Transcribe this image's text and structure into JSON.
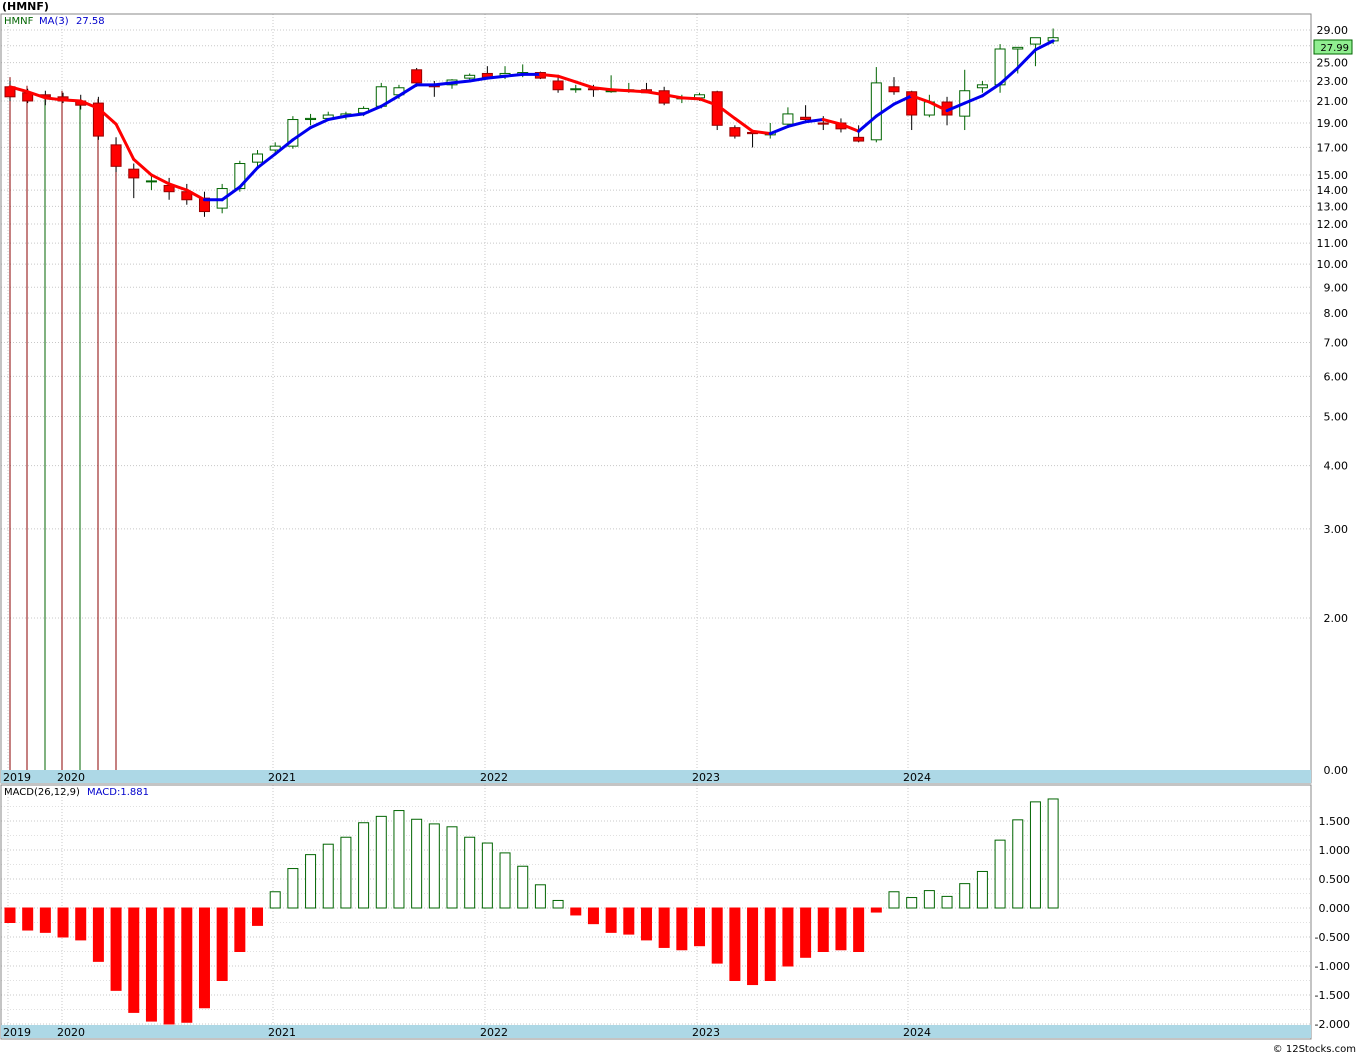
{
  "symbol_title": "(HMNF)",
  "copyright": "© 12Stocks.com",
  "colors": {
    "up": "#006400",
    "down": "#ff0000",
    "ma_rising": "#0000ee",
    "ma_falling": "#ff0000",
    "axis_band": "#add8e6",
    "grid": "#c8c8c8",
    "price_label_bg": "#90ee90"
  },
  "chart_data": [
    {
      "type": "candlestick",
      "panel": "price",
      "ticker_label": "HMNF",
      "indicator_label": "MA(3)",
      "indicator_value": "27.58",
      "last_price_label": "27.99",
      "scale": "log",
      "x_labels": [
        "2019",
        "2020",
        "2021",
        "2022",
        "2023",
        "2024"
      ],
      "y_ticks": [
        "29.00",
        "27.00",
        "25.00",
        "23.00",
        "21.00",
        "19.00",
        "17.00",
        "15.00",
        "14.00",
        "13.00",
        "12.00",
        "11.00",
        "10.00",
        "9.00",
        "8.00",
        "7.00",
        "6.00",
        "5.00",
        "4.00",
        "3.00",
        "2.00",
        "0.00"
      ],
      "grid": true,
      "candles": [
        {
          "o": 22.4,
          "h": 23.0,
          "l": 21.0,
          "c": 21.4
        },
        {
          "o": 21.8,
          "h": 22.2,
          "l": 20.8,
          "c": 21.0
        },
        {
          "o": 21.6,
          "h": 22.0,
          "l": 20.6,
          "c": 21.4
        },
        {
          "o": 21.4,
          "h": 21.8,
          "l": 20.8,
          "c": 21.0
        },
        {
          "o": 21.0,
          "h": 21.6,
          "l": 20.2,
          "c": 20.6
        },
        {
          "o": 20.8,
          "h": 21.4,
          "l": 17.6,
          "c": 17.9
        },
        {
          "o": 17.2,
          "h": 17.8,
          "l": 15.2,
          "c": 15.6
        },
        {
          "o": 15.4,
          "h": 15.8,
          "l": 13.5,
          "c": 14.8
        },
        {
          "o": 14.6,
          "h": 15.0,
          "l": 14.0,
          "c": 14.6
        },
        {
          "o": 14.3,
          "h": 14.8,
          "l": 13.4,
          "c": 13.9
        },
        {
          "o": 13.9,
          "h": 14.4,
          "l": 13.1,
          "c": 13.4
        },
        {
          "o": 13.5,
          "h": 13.9,
          "l": 12.4,
          "c": 12.7
        },
        {
          "o": 12.9,
          "h": 14.4,
          "l": 12.6,
          "c": 14.1
        },
        {
          "o": 14.1,
          "h": 16.0,
          "l": 13.9,
          "c": 15.8
        },
        {
          "o": 15.9,
          "h": 16.8,
          "l": 15.4,
          "c": 16.5
        },
        {
          "o": 16.8,
          "h": 17.4,
          "l": 16.4,
          "c": 17.1
        },
        {
          "o": 17.1,
          "h": 19.6,
          "l": 16.9,
          "c": 19.3
        },
        {
          "o": 19.3,
          "h": 19.8,
          "l": 18.8,
          "c": 19.4
        },
        {
          "o": 19.4,
          "h": 20.0,
          "l": 19.2,
          "c": 19.7
        },
        {
          "o": 19.6,
          "h": 20.0,
          "l": 19.3,
          "c": 19.8
        },
        {
          "o": 19.9,
          "h": 20.5,
          "l": 19.6,
          "c": 20.3
        },
        {
          "o": 20.5,
          "h": 22.8,
          "l": 20.3,
          "c": 22.4
        },
        {
          "o": 21.6,
          "h": 22.6,
          "l": 21.2,
          "c": 22.3
        },
        {
          "o": 24.2,
          "h": 24.4,
          "l": 22.4,
          "c": 22.8
        },
        {
          "o": 22.6,
          "h": 23.0,
          "l": 21.4,
          "c": 22.4
        },
        {
          "o": 22.6,
          "h": 23.2,
          "l": 22.2,
          "c": 23.1
        },
        {
          "o": 23.3,
          "h": 23.8,
          "l": 23.0,
          "c": 23.6
        },
        {
          "o": 23.8,
          "h": 24.6,
          "l": 23.4,
          "c": 23.4
        },
        {
          "o": 23.6,
          "h": 24.6,
          "l": 23.2,
          "c": 23.8
        },
        {
          "o": 23.7,
          "h": 24.8,
          "l": 23.4,
          "c": 23.9
        },
        {
          "o": 23.9,
          "h": 24.0,
          "l": 23.2,
          "c": 23.3
        },
        {
          "o": 23.0,
          "h": 23.6,
          "l": 21.8,
          "c": 22.1
        },
        {
          "o": 22.2,
          "h": 22.6,
          "l": 21.8,
          "c": 22.2
        },
        {
          "o": 22.2,
          "h": 22.6,
          "l": 21.4,
          "c": 22.1
        },
        {
          "o": 22.0,
          "h": 23.6,
          "l": 21.8,
          "c": 22.0
        },
        {
          "o": 22.0,
          "h": 22.8,
          "l": 21.8,
          "c": 22.1
        },
        {
          "o": 22.1,
          "h": 22.8,
          "l": 21.8,
          "c": 21.8
        },
        {
          "o": 22.0,
          "h": 22.4,
          "l": 20.6,
          "c": 20.8
        },
        {
          "o": 21.3,
          "h": 21.6,
          "l": 20.8,
          "c": 21.3
        },
        {
          "o": 21.3,
          "h": 21.8,
          "l": 21.0,
          "c": 21.6
        },
        {
          "o": 21.9,
          "h": 22.0,
          "l": 18.4,
          "c": 18.8
        },
        {
          "o": 18.6,
          "h": 18.8,
          "l": 17.7,
          "c": 17.9
        },
        {
          "o": 18.2,
          "h": 18.4,
          "l": 17.0,
          "c": 18.1
        },
        {
          "o": 18.0,
          "h": 19.0,
          "l": 17.7,
          "c": 18.2
        },
        {
          "o": 18.9,
          "h": 20.4,
          "l": 18.7,
          "c": 19.8
        },
        {
          "o": 19.5,
          "h": 20.6,
          "l": 19.2,
          "c": 19.3
        },
        {
          "o": 19.0,
          "h": 19.6,
          "l": 18.4,
          "c": 18.9
        },
        {
          "o": 19.0,
          "h": 19.4,
          "l": 18.2,
          "c": 18.5
        },
        {
          "o": 17.8,
          "h": 18.8,
          "l": 17.4,
          "c": 17.5
        },
        {
          "o": 17.6,
          "h": 24.5,
          "l": 17.4,
          "c": 22.8
        },
        {
          "o": 22.4,
          "h": 23.4,
          "l": 21.6,
          "c": 21.9
        },
        {
          "o": 21.9,
          "h": 22.0,
          "l": 18.4,
          "c": 19.7
        },
        {
          "o": 19.7,
          "h": 21.6,
          "l": 19.5,
          "c": 20.9
        },
        {
          "o": 20.9,
          "h": 21.4,
          "l": 18.8,
          "c": 19.7
        },
        {
          "o": 19.6,
          "h": 24.2,
          "l": 18.4,
          "c": 22.0
        },
        {
          "o": 22.3,
          "h": 23.0,
          "l": 21.8,
          "c": 22.6
        },
        {
          "o": 22.6,
          "h": 27.2,
          "l": 21.8,
          "c": 26.6
        },
        {
          "o": 26.6,
          "h": 26.8,
          "l": 23.8,
          "c": 26.8
        },
        {
          "o": 27.2,
          "h": 28.0,
          "l": 24.6,
          "c": 28.0
        },
        {
          "o": 27.6,
          "h": 29.2,
          "l": 27.2,
          "c": 28.0
        }
      ],
      "moving_average": {
        "name": "MA(3)",
        "values": [
          22.4,
          21.9,
          21.3,
          21.1,
          21.0,
          20.3,
          18.9,
          16.1,
          15.0,
          14.4,
          14.0,
          13.4,
          13.4,
          14.2,
          15.5,
          16.5,
          17.6,
          18.6,
          19.3,
          19.6,
          19.8,
          20.5,
          21.5,
          22.6,
          22.6,
          22.8,
          23.0,
          23.3,
          23.5,
          23.7,
          23.7,
          23.5,
          22.9,
          22.3,
          22.1,
          22.0,
          21.9,
          21.6,
          21.3,
          21.2,
          20.6,
          19.4,
          18.3,
          18.1,
          18.7,
          19.1,
          19.3,
          18.9,
          18.3,
          19.6,
          20.7,
          21.5,
          20.9,
          20.1,
          20.8,
          21.5,
          22.7,
          24.4,
          26.5,
          27.6
        ]
      },
      "volume_year_bars": [
        {
          "y": 23.4,
          "dir": "down"
        },
        {
          "y": 22.5,
          "dir": "down"
        },
        {
          "y": 21.6,
          "dir": "up"
        },
        {
          "y": 22.0,
          "dir": "down"
        },
        {
          "y": 21.0,
          "dir": "up"
        },
        {
          "y": 21.2,
          "dir": "down"
        },
        {
          "y": 17.8,
          "dir": "down"
        }
      ]
    },
    {
      "type": "bar",
      "panel": "macd",
      "indicator_label": "MACD(26,12,9)",
      "indicator_value": "MACD:1.881",
      "x_labels": [
        "2019",
        "2020",
        "2021",
        "2022",
        "2023",
        "2024"
      ],
      "y_ticks": [
        "1.500",
        "1.000",
        "0.500",
        "0.000",
        "-0.500",
        "-1.000",
        "-1.500",
        "-2.000"
      ],
      "ylim": [
        -2.0,
        2.2
      ],
      "grid": true,
      "values": [
        -0.25,
        -0.38,
        -0.42,
        -0.5,
        -0.55,
        -0.92,
        -1.42,
        -1.8,
        -1.95,
        -2.0,
        -1.97,
        -1.72,
        -1.25,
        -0.75,
        -0.3,
        0.28,
        0.68,
        0.92,
        1.1,
        1.22,
        1.47,
        1.58,
        1.68,
        1.53,
        1.45,
        1.4,
        1.22,
        1.12,
        0.95,
        0.72,
        0.4,
        0.13,
        -0.12,
        -0.27,
        -0.42,
        -0.45,
        -0.55,
        -0.68,
        -0.72,
        -0.65,
        -0.95,
        -1.25,
        -1.32,
        -1.25,
        -1.0,
        -0.85,
        -0.75,
        -0.72,
        -0.75,
        -0.07,
        0.28,
        0.18,
        0.3,
        0.2,
        0.42,
        0.63,
        1.17,
        1.52,
        1.83,
        1.88
      ]
    }
  ]
}
